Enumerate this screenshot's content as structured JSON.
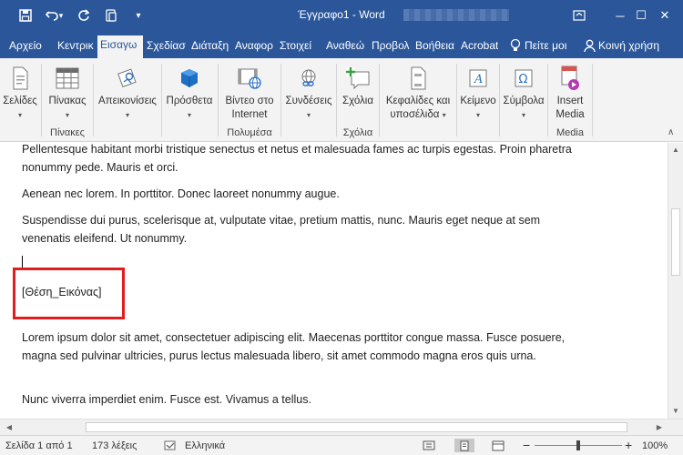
{
  "window": {
    "title": "Έγγραφο1 - Word",
    "minimize_glyph": "─",
    "maximize_glyph": "☐",
    "close_glyph": "✕",
    "accent_color": "#2b579a"
  },
  "quick_access": {
    "icons": [
      "save-icon",
      "undo-icon",
      "redo-icon",
      "touch-mode-icon",
      "customize-icon"
    ],
    "undo_caret": "▾",
    "customize_glyph": "▾"
  },
  "tabs": [
    {
      "label": "Αρχείο"
    },
    {
      "label": "Κεντρικ"
    },
    {
      "label": "Εισαγω",
      "active": true
    },
    {
      "label": "Σχεδίασ"
    },
    {
      "label": "Διάταξη"
    },
    {
      "label": "Αναφορ"
    },
    {
      "label": "Στοιχεί"
    },
    {
      "label": "Αναθεώ"
    },
    {
      "label": "Προβολ"
    },
    {
      "label": "Βοήθεια"
    },
    {
      "label": "Acrobat"
    }
  ],
  "tell_me": "Πείτε μοι",
  "share": "Κοινή χρήση",
  "ribbon": {
    "pages": {
      "label": "Σελίδες",
      "caret": "▾"
    },
    "tables": {
      "label": "Πίνακας",
      "caret": "▾",
      "group": "Πίνακες"
    },
    "illustrations": {
      "label": "Απεικονίσεις",
      "caret": "▾"
    },
    "addins": {
      "label": "Πρόσθετα",
      "caret": "▾"
    },
    "video": {
      "line1": "Βίντεο στο",
      "line2": "Internet",
      "group": "Πολυμέσα"
    },
    "links": {
      "label": "Συνδέσεις",
      "caret": "▾"
    },
    "comment": {
      "label": "Σχόλια",
      "group": "Σχόλια"
    },
    "header_footer": {
      "line1": "Κεφαλίδες και",
      "line2": "υποσέλιδα",
      "caret": "▾"
    },
    "text": {
      "label": "Κείμενο",
      "caret": "▾"
    },
    "symbols": {
      "label": "Σύμβολα",
      "caret": "▾"
    },
    "media": {
      "line1": "Insert",
      "line2": "Media",
      "group": "Media"
    },
    "collapse_glyph": "∧"
  },
  "document": {
    "paragraphs": [
      "Pellentesque habitant morbi tristique senectus et netus et malesuada fames ac turpis egestas. Proin pharetra nonummy pede. Mauris et orci.",
      "Aenean nec lorem. In porttitor. Donec laoreet nonummy augue.",
      "Suspendisse dui purus, scelerisque at, vulputate vitae, pretium mattis, nunc. Mauris eget neque at sem venenatis eleifend. Ut nonummy.",
      "Lorem ipsum dolor sit amet, consectetuer adipiscing elit. Maecenas porttitor congue massa. Fusce posuere, magna sed pulvinar ultricies, purus lectus malesuada libero, sit amet commodo magna eros quis urna.",
      "Nunc viverra imperdiet enim. Fusce est. Vivamus a tellus."
    ],
    "placeholder": "[Θέση_Εικόνας]",
    "highlight_color": "#e01e1e"
  },
  "scroll": {
    "up": "▲",
    "down": "▼",
    "left": "◀",
    "right": "▶"
  },
  "status": {
    "page": "Σελίδα 1 από 1",
    "words": "173 λέξεις",
    "language": "Ελληνικά",
    "zoom_minus": "−",
    "zoom_plus": "+",
    "zoom": "100%",
    "zoom_slider_level": 0.5
  }
}
